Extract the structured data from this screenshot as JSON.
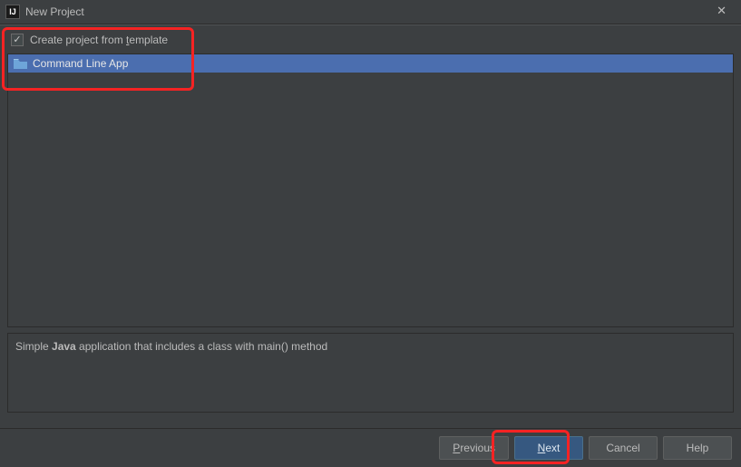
{
  "titlebar": {
    "icon_text": "IJ",
    "title": "New Project",
    "close_glyph": "✕"
  },
  "options": {
    "checkbox_checked_glyph": "✓",
    "create_from_template_pre": "Create project from ",
    "create_from_template_underline": "t",
    "create_from_template_post": "emplate"
  },
  "templates": {
    "items": [
      {
        "label": "Command Line App"
      }
    ]
  },
  "description": {
    "pre": "Simple ",
    "bold": "Java",
    "post": " application that includes a class with main() method"
  },
  "footer": {
    "previous_underline": "P",
    "previous_rest": "revious",
    "next_underline": "N",
    "next_rest": "ext",
    "cancel": "Cancel",
    "help": "Help"
  }
}
